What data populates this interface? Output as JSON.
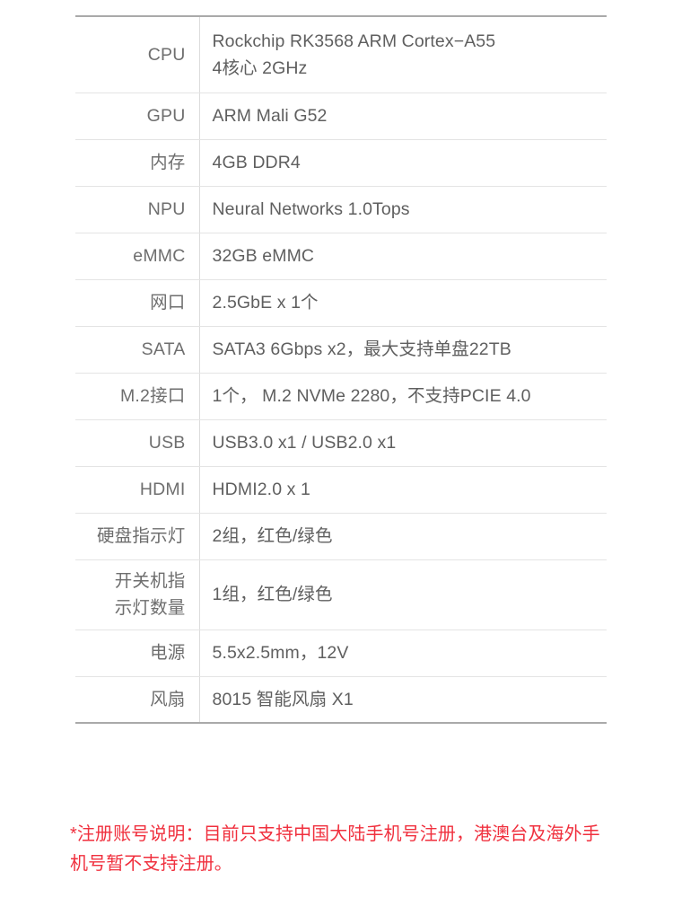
{
  "spec_table": {
    "rows": [
      {
        "label": "CPU",
        "value": "Rockchip RK3568 ARM Cortex−A55\n 4核心 2GHz",
        "size": "cpu"
      },
      {
        "label": "GPU",
        "value": "ARM Mali G52",
        "size": "std"
      },
      {
        "label": "内存",
        "value": "4GB DDR4",
        "size": "std"
      },
      {
        "label": "NPU",
        "value": "Neural Networks 1.0Tops",
        "size": "std"
      },
      {
        "label": "eMMC",
        "value": "32GB eMMC",
        "size": "std"
      },
      {
        "label": "网口",
        "value": "2.5GbE x 1个",
        "size": "std"
      },
      {
        "label": "SATA",
        "value": "SATA3 6Gbps x2，最大支持单盘22TB",
        "size": "std"
      },
      {
        "label": "M.2接口",
        "value": "1个， M.2 NVMe 2280，不支持PCIE 4.0",
        "size": "std"
      },
      {
        "label": "USB",
        "value": "USB3.0 x1 / USB2.0 x1",
        "size": "std"
      },
      {
        "label": "HDMI",
        "value": "HDMI2.0 x 1",
        "size": "std"
      },
      {
        "label": "硬盘指示灯",
        "value": "2组，红色/绿色",
        "size": "std"
      },
      {
        "label": "开关机指\n示灯数量",
        "value": "1组，红色/绿色",
        "size": "tall"
      },
      {
        "label": "电源",
        "value": "5.5x2.5mm，12V",
        "size": "std"
      },
      {
        "label": "风扇",
        "value": "8015 智能风扇 X1",
        "size": "std"
      }
    ]
  },
  "footnote": {
    "text": "*注册账号说明：目前只支持中国大陆手机号注册，港澳台及海外手机号暂不支持注册。",
    "color": "#f0303e"
  },
  "colors": {
    "label_text": "#6e6e6e",
    "value_text": "#5f5f5f",
    "table_outer_border": "#aaaaaa",
    "row_border": "#e4e4e4",
    "column_divider": "#dcdcdc",
    "background": "#ffffff"
  }
}
